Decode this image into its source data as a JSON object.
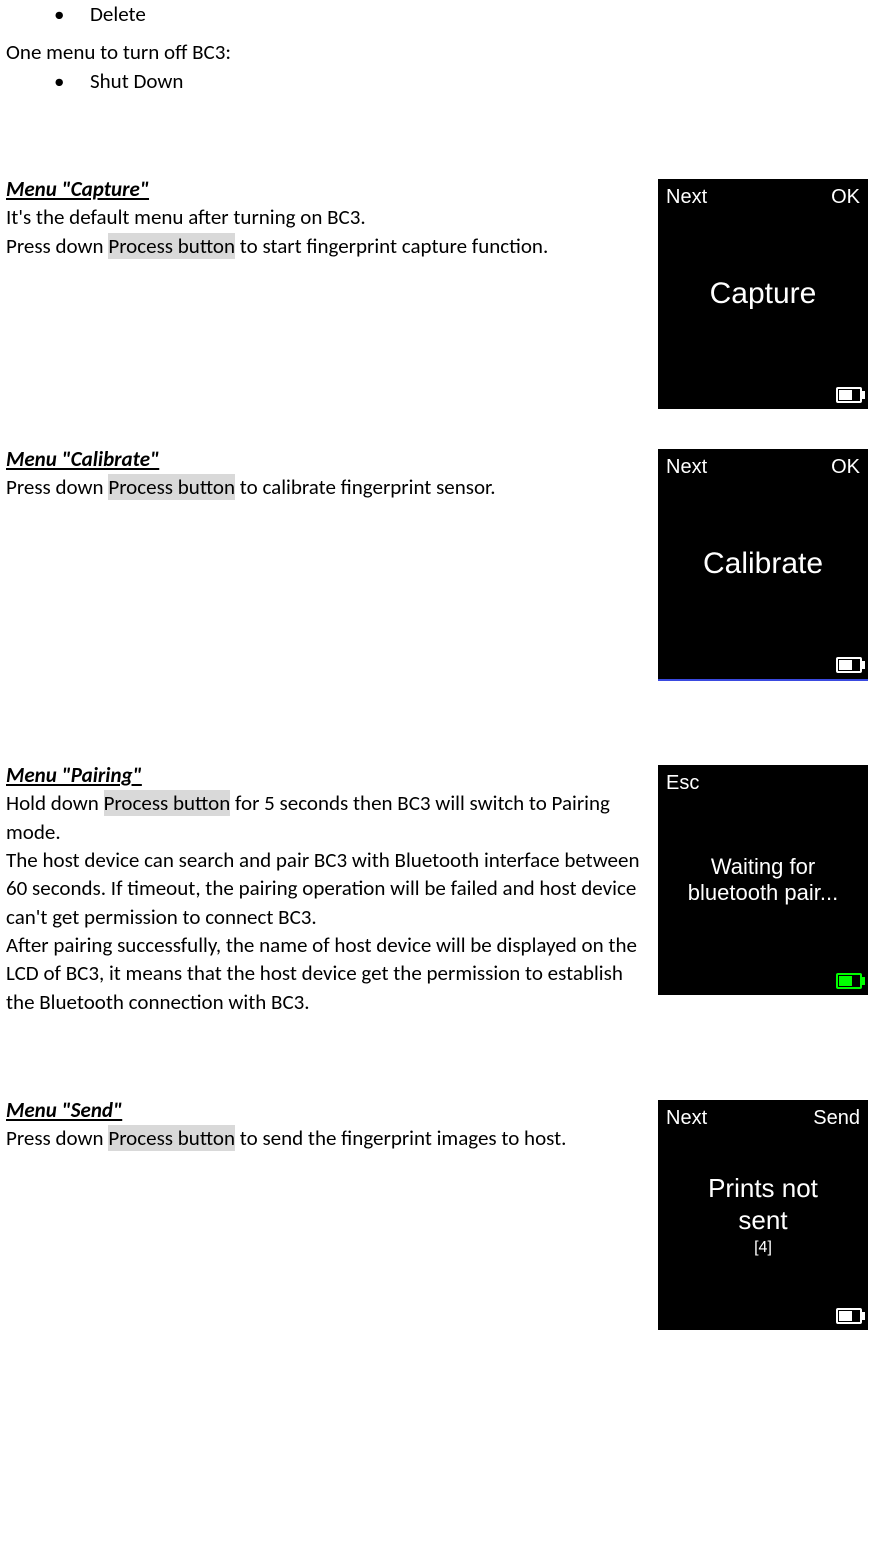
{
  "intro": {
    "bullet1": "Delete",
    "line": "One menu to turn off BC3:",
    "bullet2": "Shut Down"
  },
  "capture": {
    "heading": "Menu \"Capture\"",
    "line1": "It's the default menu after turning on BC3.",
    "line2a": "Press down ",
    "line2hl": "Process button",
    "line2b": " to start fingerprint capture function.",
    "screen": {
      "left": "Next",
      "right": "OK",
      "center": "Capture"
    }
  },
  "calibrate": {
    "heading": "Menu \"Calibrate\"",
    "line1a": "Press down ",
    "line1hl": "Process button",
    "line1b": " to calibrate fingerprint sensor.",
    "screen": {
      "left": "Next",
      "right": "OK",
      "center": "Calibrate"
    }
  },
  "pairing": {
    "heading": "Menu \"Pairing\"",
    "line1a": "Hold down ",
    "line1hl": "Process button",
    "line1b": " for 5 seconds then BC3 will switch to Pairing mode.",
    "para2": "The host device can search and pair BC3 with Bluetooth interface between 60 seconds. If timeout, the pairing operation will be failed and host device can't get permission to connect BC3.",
    "para3": "After pairing successfully, the name of host device will be displayed on the LCD of BC3, it means that the host device get the permission to establish the Bluetooth connection with BC3.",
    "screen": {
      "left": "Esc",
      "line1": "Waiting for",
      "line2": "bluetooth pair..."
    }
  },
  "send": {
    "heading": "Menu \"Send\"",
    "line1a": "Press down ",
    "line1hl": "Process button",
    "line1b": " to send the fingerprint images to host.",
    "screen": {
      "left": "Next",
      "right": "Send",
      "line1": "Prints not",
      "line2": "sent",
      "count": "[4]"
    }
  }
}
